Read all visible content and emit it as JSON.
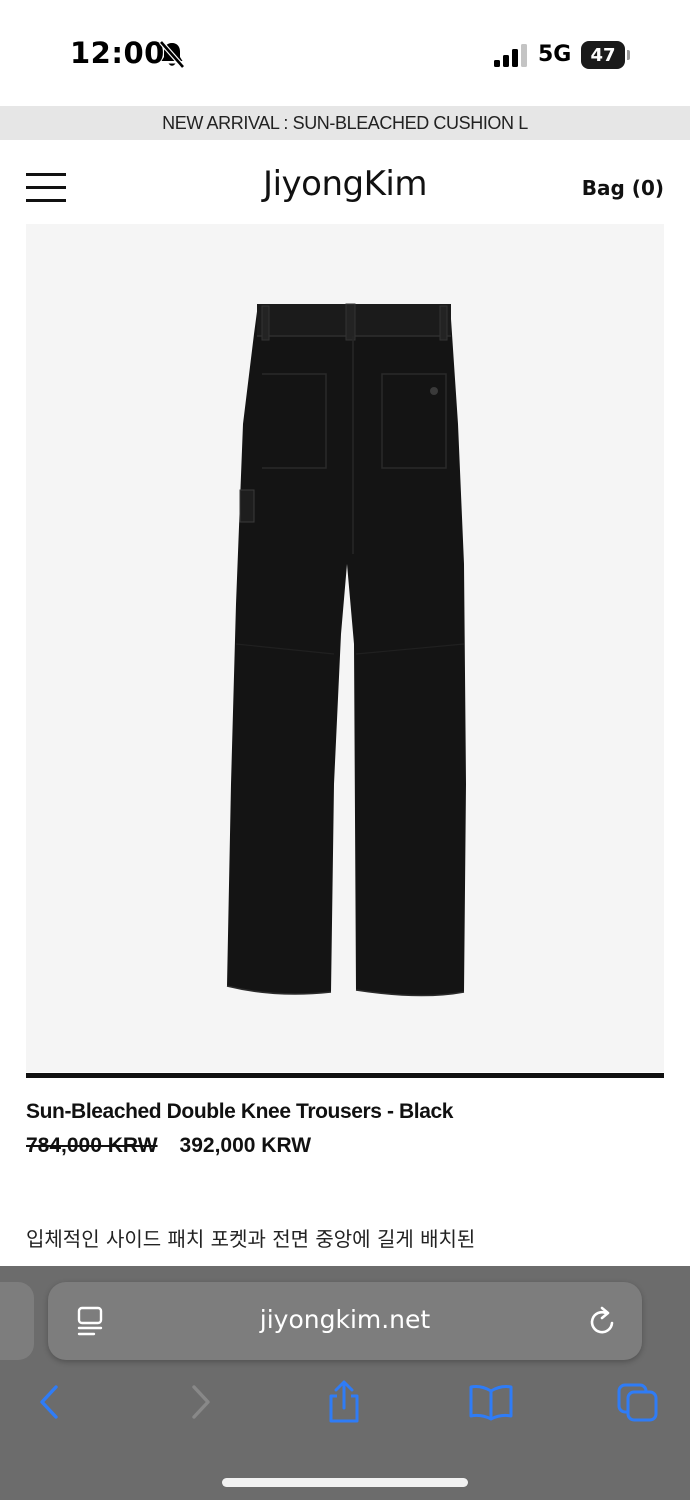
{
  "status_bar": {
    "time": "12:00",
    "network": "5G",
    "battery": "47"
  },
  "announcement": {
    "text": "NEW ARRIVAL : SUN-BLEACHED CUSHION L"
  },
  "header": {
    "brand": "JiyongKim",
    "bag_label": "Bag (0)"
  },
  "product": {
    "title": "Sun-Bleached Double Knee Trousers - Black",
    "original_price": "784,000 KRW",
    "sale_price": "392,000 KRW",
    "description": "입체적인 사이드 패치 포켓과 전면 중앙에 길게 배치된"
  },
  "browser": {
    "url": "jiyongkim.net"
  },
  "colors": {
    "accent_blue": "#2f7cf6",
    "chrome_gray": "#6c6c6c"
  },
  "icons": [
    "bell-slash-icon",
    "signal-icon",
    "battery-icon",
    "menu-icon",
    "page-menu-icon",
    "reload-icon",
    "back-icon",
    "forward-icon",
    "share-icon",
    "bookmarks-icon",
    "tabs-icon"
  ]
}
